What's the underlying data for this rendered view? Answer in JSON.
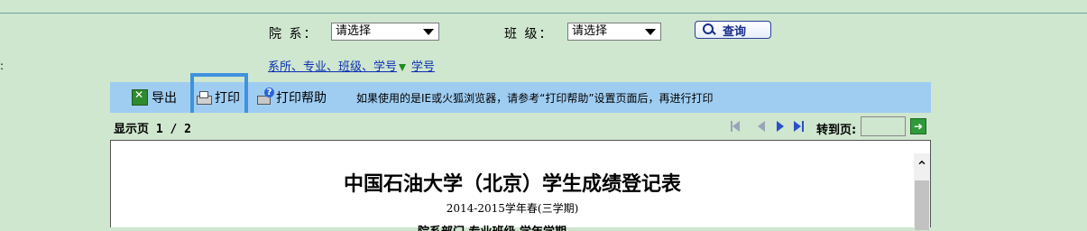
{
  "filters": {
    "dept_label": "院 系：",
    "dept_value": "请选择",
    "class_label": "班 级：",
    "class_value": "请选择",
    "query_button": "查询"
  },
  "sort": {
    "by_dept_link": "系所、专业、班级、学号",
    "by_id_link": "学号"
  },
  "toolbar": {
    "export_label": "导出",
    "print_label": "打印",
    "print_help_label": "打印帮助",
    "tip": "如果使用的是IE或火狐浏览器，请参考“打印帮助”设置页面后，再进行打印"
  },
  "pager": {
    "page_info": "显示页 1 / 2",
    "goto_label": "转到页:",
    "goto_value": ""
  },
  "report": {
    "title": "中国石油大学（北京）学生成绩登记表",
    "term": "2014-2015学年春(三学期)",
    "partial_line": "院系部门 专业班级 学年学期"
  },
  "colors": {
    "background": "#cfe6cf",
    "toolbar": "#9fcdf2",
    "highlight": "#3f92de",
    "link": "#0a2fb3"
  }
}
